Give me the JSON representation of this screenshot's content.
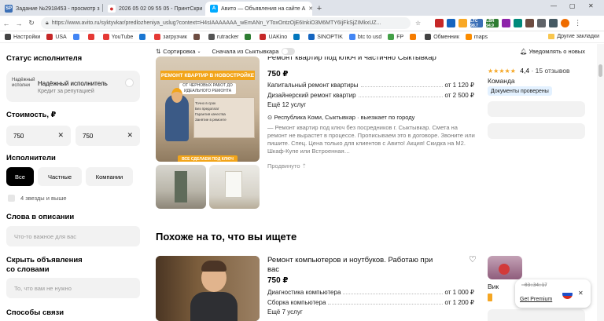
{
  "browser": {
    "tabs": [
      {
        "title": "Задание №2918453 - просмотр з",
        "favicon": "SP",
        "favicon_color": "#3b6fb6",
        "active": false
      },
      {
        "title": "2026 05 02 09 55 05 - ПринтСкри",
        "favicon": "●",
        "favicon_color": "#d32f2f",
        "active": false
      },
      {
        "title": "Авито — Объявления на сайте А",
        "favicon": "A",
        "favicon_color": "#00aaff",
        "active": true
      }
    ],
    "new_tab": "+",
    "window_controls": [
      "—",
      "▢",
      "✕"
    ],
    "url": "https://www.avito.ru/syktyvkar/predlozheniya_uslug?context=H4sIAAAAAAA_wEmANn_YToxOntzOjE6InkiO3M6MTY6IjFkSjZIMkxUZ...",
    "extensions": [
      {
        "label": "LTC 98.7",
        "color": "#3b6fb6"
      },
      {
        "label": "LBR 94.9",
        "color": "#2e7d32"
      }
    ]
  },
  "bookmarks": {
    "items": [
      {
        "label": "Настройки",
        "color": "#444"
      },
      {
        "label": "USA",
        "color": "#c62828"
      },
      {
        "label": "",
        "color": "#4285f4"
      },
      {
        "label": "",
        "color": "#e53935"
      },
      {
        "label": "YouTube",
        "color": "#e53935"
      },
      {
        "label": "",
        "color": "#1976d2"
      },
      {
        "label": "загрузчик",
        "color": "#e53935"
      },
      {
        "label": "",
        "color": "#6d4c41"
      },
      {
        "label": "rutracker",
        "color": "#555"
      },
      {
        "label": "",
        "color": "#2e7d32"
      },
      {
        "label": "UAKino",
        "color": "#c62828"
      },
      {
        "label": "",
        "color": "#0277bd"
      },
      {
        "label": "SINOPTIK",
        "color": "#1565c0"
      },
      {
        "label": "btc to usd",
        "color": "#4285f4"
      },
      {
        "label": "FP",
        "color": "#43a047"
      },
      {
        "label": "",
        "color": "#f57c00"
      },
      {
        "label": "Обменник",
        "color": "#424242"
      },
      {
        "label": "maps",
        "color": "#fb8c00"
      }
    ],
    "other": "Другие закладки"
  },
  "filters": {
    "status_title": "Статус исполнителя",
    "verified_img_alt": "Надёжный исполни",
    "verified_title": "Надёжный исполнитель",
    "verified_sub": "Кредит за репутацией",
    "cost_title": "Стоимость, ₽",
    "price_from": "750",
    "price_to": "750",
    "executors_title": "Исполнители",
    "executor_options": [
      "Все",
      "Частные",
      "Компании"
    ],
    "stars_label": "4 звезды и выше",
    "words_title": "Слова в описании",
    "words_placeholder": "Что-то важное для вас",
    "hide_title_1": "Скрыть объявления",
    "hide_title_2": "со словами",
    "hide_placeholder": "То, что вам не нужно",
    "contact_title": "Способы связи"
  },
  "toolbar": {
    "sort": "Сортировка",
    "first_in": "Сначала из Сыктывкара",
    "notify": "Уведомлять о новых"
  },
  "ad1": {
    "image_banner": "РЕМОНТ КВАРТИР В НОВОСТРОЙКЕ",
    "image_sub": "ОТ ЧЕРНОВЫХ РАБОТ ДО ИДЕАЛЬНОГО РЕМОНТА",
    "image_cta": "ВСЕ СДЕЛАЕМ ПОД КЛЮЧ",
    "image_checks": [
      "Точно в срок",
      "Без предоплат",
      "Гарантия качества",
      "Занятие в ремонте"
    ],
    "title": "Ремонт квартир под ключ и частично Сыктывкар",
    "price": "750 ₽",
    "services": [
      {
        "name": "Капитальный ремонт квартиры",
        "price": "от 1 120 ₽"
      },
      {
        "name": "Дизайнерский ремонт квартир",
        "price": "от 2 500 ₽"
      }
    ],
    "more": "Ещё 12 услуг",
    "location_icon": "⊙",
    "location": "Республика Коми, Сыктывкар · выезжает по городу",
    "description": "— Ремонт квартир под ключ без посредников г. Сыктывкар. Смета на ремонт не вырастет в процессе. Прописываем это в договоре. Звоните или пишите. Спец. Цена только для клиентов с Авито! Акция! Скидка на М2. Шкаф-Купе или Встроенная…",
    "promoted": "Продвинуто"
  },
  "seller1": {
    "rating": "4,4",
    "reviews": "15 отзывов",
    "type": "Команда",
    "badge": "Документы проверены"
  },
  "similar": {
    "title": "Похоже на то, что вы ищете"
  },
  "ad2": {
    "title_1": "Ремонт компьютеров и ноутбуков. Работаю при",
    "title_2": "вас",
    "price": "750 ₽",
    "services": [
      {
        "name": "Диагностика компьютера",
        "price": "от 1 000 ₽"
      },
      {
        "name": "Сборка компьютера",
        "price": "от 1 200 ₽"
      }
    ],
    "more": "Ещё 7 услуг"
  },
  "seller2": {
    "name": "Вик"
  },
  "popup": {
    "time": "03:34:17",
    "label": "Get Premium"
  },
  "colors": {
    "accent_blue": "#00aaff",
    "badge_bg": "#e3f1ff",
    "star": "#f5a623",
    "banner_orange": "#f2a51a"
  }
}
